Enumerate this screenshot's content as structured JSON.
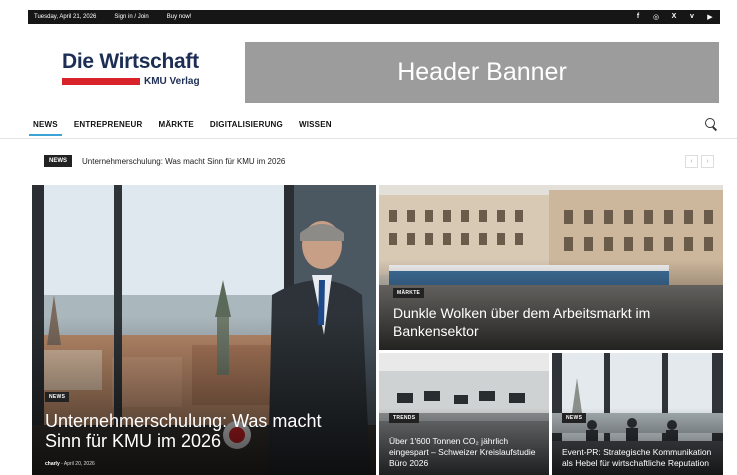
{
  "topbar": {
    "date": "Tuesday, April 21, 2026",
    "signin": "Sign in / Join",
    "buynow": "Buy now!",
    "socials": [
      "f",
      "◎",
      "X",
      "v",
      "▶"
    ]
  },
  "logo": {
    "main": "Die Wirtschaft",
    "sub": "KMU Verlag"
  },
  "banner": {
    "text": "Header Banner"
  },
  "nav": {
    "items": [
      "NEWS",
      "ENTREPRENEUR",
      "MÄRKTE",
      "DIGITALISIERUNG",
      "WISSEN"
    ]
  },
  "ticker": {
    "tag": "NEWS",
    "headline": "Unternehmerschulung: Was macht Sinn für KMU im 2026",
    "prev": "‹",
    "next": "›"
  },
  "cards": [
    {
      "category": "NEWS",
      "title": "Unternehmerschulung: Was macht Sinn für KMU im 2026",
      "author": "charly",
      "date": "April 20, 2026"
    },
    {
      "category": "MÄRKTE",
      "title": "Dunkle Wolken über dem Arbeitsmarkt im Bankensektor"
    },
    {
      "category": "TRENDS",
      "title": "Über 1'600 Tonnen CO₂ jährlich eingespart – Schweizer Kreislaufstudie Büro 2026"
    },
    {
      "category": "NEWS",
      "title": "Event-PR: Strategische Kommunikation als Hebel für wirtschaftliche Reputation"
    }
  ],
  "colors": {
    "accent": "#3ba3d6",
    "logo_red": "#d8232a",
    "logo_navy": "#1d2e55",
    "topbar": "#161616",
    "banner": "#9c9c9c"
  }
}
